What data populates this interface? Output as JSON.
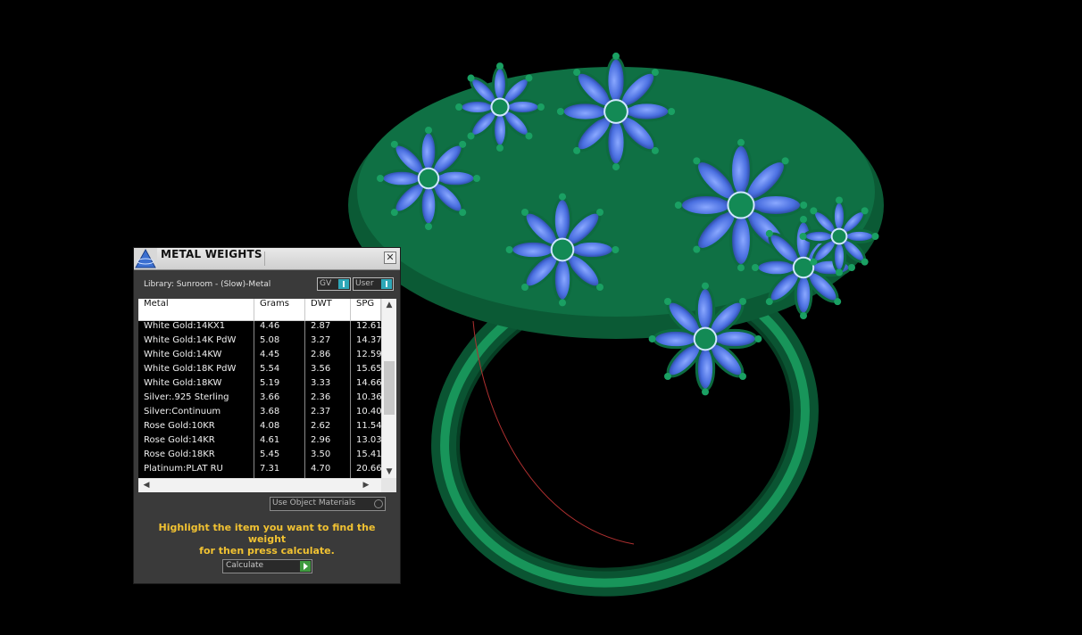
{
  "panel": {
    "title": "METAL WEIGHTS",
    "close_glyph": "✕",
    "library_label": "Library: Sunroom - (Slow)-Metal",
    "toggles": [
      {
        "label": "GV"
      },
      {
        "label": "User"
      }
    ],
    "table": {
      "headers": {
        "metal": "Metal",
        "grams": "Grams",
        "dwt": "DWT",
        "spg": "SPG"
      },
      "rows": [
        {
          "metal": "White Gold:14KX1",
          "grams": "4.46",
          "dwt": "2.87",
          "spg": "12.61"
        },
        {
          "metal": "White Gold:14K PdW",
          "grams": "5.08",
          "dwt": "3.27",
          "spg": "14.37"
        },
        {
          "metal": "White Gold:14KW",
          "grams": "4.45",
          "dwt": "2.86",
          "spg": "12.59"
        },
        {
          "metal": "White Gold:18K PdW",
          "grams": "5.54",
          "dwt": "3.56",
          "spg": "15.65"
        },
        {
          "metal": "White Gold:18KW",
          "grams": "5.19",
          "dwt": "3.33",
          "spg": "14.66"
        },
        {
          "metal": "Silver:.925 Sterling",
          "grams": "3.66",
          "dwt": "2.36",
          "spg": "10.36"
        },
        {
          "metal": "Silver:Continuum",
          "grams": "3.68",
          "dwt": "2.37",
          "spg": "10.40"
        },
        {
          "metal": "Rose Gold:10KR",
          "grams": "4.08",
          "dwt": "2.62",
          "spg": "11.54"
        },
        {
          "metal": "Rose Gold:14KR",
          "grams": "4.61",
          "dwt": "2.96",
          "spg": "13.03"
        },
        {
          "metal": "Rose Gold:18KR",
          "grams": "5.45",
          "dwt": "3.50",
          "spg": "15.41"
        },
        {
          "metal": "Platinum:PLAT RU",
          "grams": "7.31",
          "dwt": "4.70",
          "spg": "20.66"
        }
      ]
    },
    "scroll": {
      "up": "▲",
      "down": "▼",
      "left": "◀",
      "right": "▶"
    },
    "use_object_materials": "Use Object Materials",
    "hint_line1": "Highlight the item you want to find the weight",
    "hint_line2": "for then press calculate.",
    "calculate_label": "Calculate"
  },
  "colors": {
    "ring_metal": "#0d6b3f",
    "gem_blue": "#4a6fe0",
    "hint_text": "#f1c232",
    "toggle_accent": "#2ea7b8",
    "calculate_go": "#3e9a3e"
  }
}
